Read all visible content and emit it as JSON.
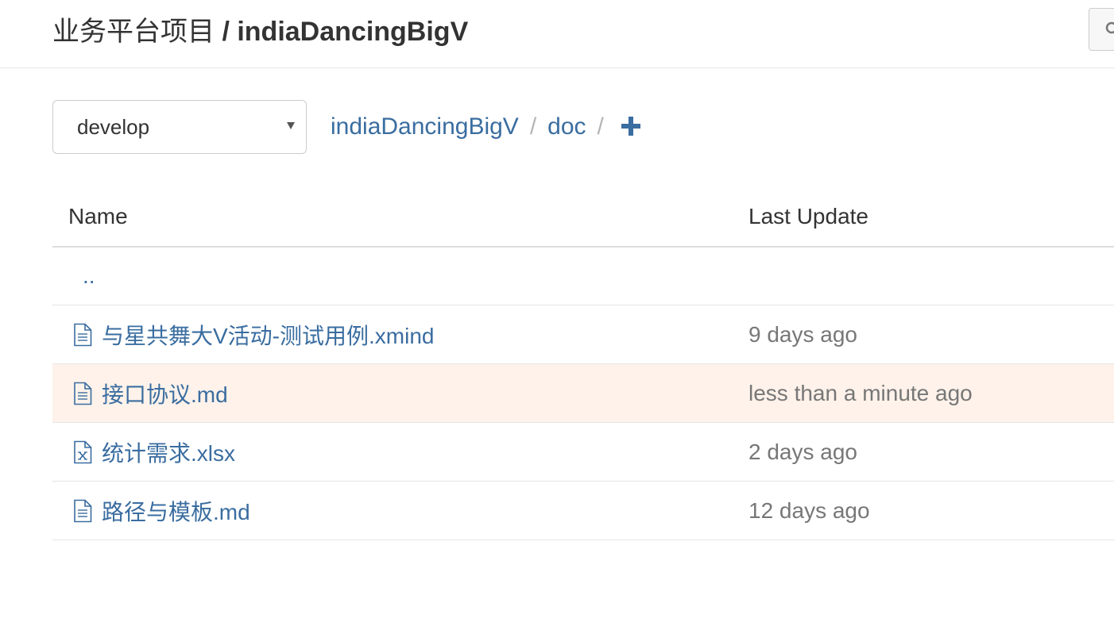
{
  "header": {
    "group": "业务平台项目",
    "separator": " / ",
    "project": "indiaDancingBigV"
  },
  "branch": {
    "selected": "develop"
  },
  "breadcrumb": {
    "items": [
      "indiaDancingBigV",
      "doc"
    ],
    "separator": "/"
  },
  "table": {
    "columns": {
      "name": "Name",
      "last_update": "Last Update"
    },
    "parent_link": "..",
    "files": [
      {
        "name": "与星共舞大V活动-测试用例.xmind",
        "updated": "9 days ago",
        "icon": "file-text-icon"
      },
      {
        "name": "接口协议.md",
        "updated": "less than a minute ago",
        "icon": "file-text-icon"
      },
      {
        "name": "统计需求.xlsx",
        "updated": "2 days ago",
        "icon": "file-excel-icon"
      },
      {
        "name": "路径与模板.md",
        "updated": "12 days ago",
        "icon": "file-text-icon"
      }
    ]
  },
  "colors": {
    "link": "#3a6da0",
    "highlight_row": "#fef2ea",
    "muted": "#777777"
  }
}
